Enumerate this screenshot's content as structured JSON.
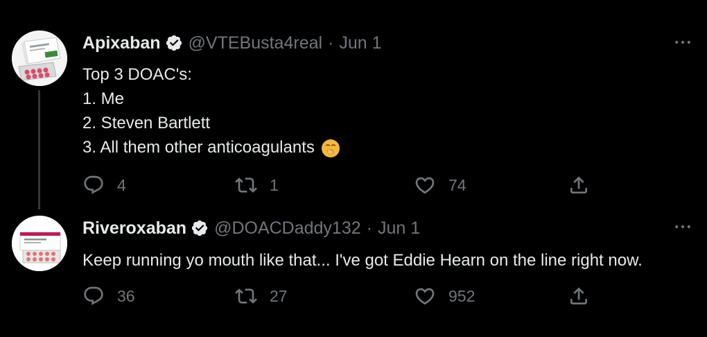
{
  "tweets": [
    {
      "name": "Apixaban",
      "handle": "@VTEBusta4real",
      "separator": "·",
      "date": "Jun 1",
      "text_lines": [
        "Top 3 DOAC's:",
        "1. Me",
        "2. Steven Bartlett",
        "3. All them other anticoagulants"
      ],
      "emoji": "yawning-face",
      "replies": "4",
      "retweets": "1",
      "likes": "74",
      "avatar_icon": "apixaban-pill-box"
    },
    {
      "name": "Riveroxaban",
      "handle": "@DOACDaddy132",
      "separator": "·",
      "date": "Jun 1",
      "text_lines": [
        "Keep running yo mouth like that... I've got Eddie Hearn on the line right now."
      ],
      "replies": "36",
      "retweets": "27",
      "likes": "952",
      "avatar_icon": "rivaroxaban-pill-box"
    }
  ],
  "colors": {
    "background": "#000000",
    "primary_text": "#e7e9ea",
    "secondary_text": "#71767b",
    "thread_line": "#333639"
  }
}
